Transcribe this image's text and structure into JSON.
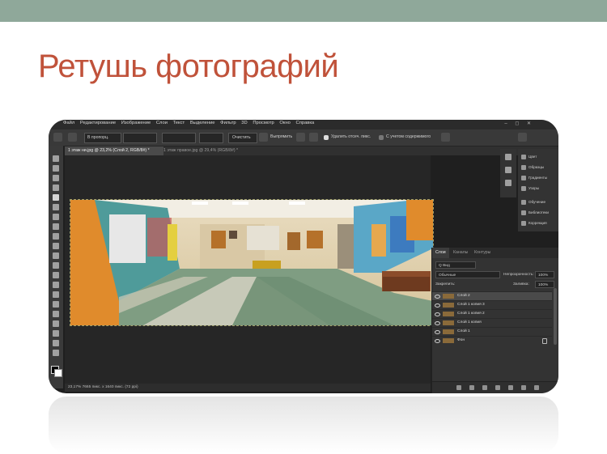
{
  "slide": {
    "title": "Ретушь фотографий"
  },
  "photoshop": {
    "menu": [
      "Файл",
      "Редактирование",
      "Изображение",
      "Слои",
      "Текст",
      "Выделение",
      "Фильтр",
      "3D",
      "Просмотр",
      "Окно",
      "Справка"
    ],
    "window_controls": "– ◻ ✕",
    "options": {
      "ratio_value": "В пропорц.",
      "clear_label": "Очистить",
      "straighten_label": "Выпрямить",
      "delete_cropped_label": "Удалить отсеч. пикс.",
      "content_aware_label": "С учетом содержимого"
    },
    "tabs": [
      {
        "label": "1 этаж ни.jpg @ 23,2% (Слой 2, RGB/8#) *"
      },
      {
        "label": "1 этаж правое.jpg @ 29,4% (RGB/8#) *"
      }
    ],
    "status": "23,17%      7665 пикс. х 1640 пикс. (72 ppi)",
    "panels_list": [
      "Цвет",
      "Образцы",
      "Градиенты",
      "Узоры",
      "Обучение",
      "Библиотеки",
      "Коррекция"
    ],
    "layers_panel": {
      "tabs": [
        "Слои",
        "Каналы",
        "Контуры"
      ],
      "filter_value": "Q Вид",
      "blend_mode": "Обычные",
      "opacity_label": "Непрозрачность:",
      "opacity_value": "100%",
      "lock_label": "Закрепить:",
      "fill_label": "Заливка:",
      "fill_value": "100%",
      "layers": [
        {
          "name": "Слой 2",
          "selected": true
        },
        {
          "name": "Слой 1 копия 3",
          "selected": false
        },
        {
          "name": "Слой 1 копия 2",
          "selected": false
        },
        {
          "name": "Слой 1 копия",
          "selected": false
        },
        {
          "name": "Слой 1",
          "selected": false
        },
        {
          "name": "Фон",
          "selected": false,
          "locked": true
        }
      ]
    }
  }
}
